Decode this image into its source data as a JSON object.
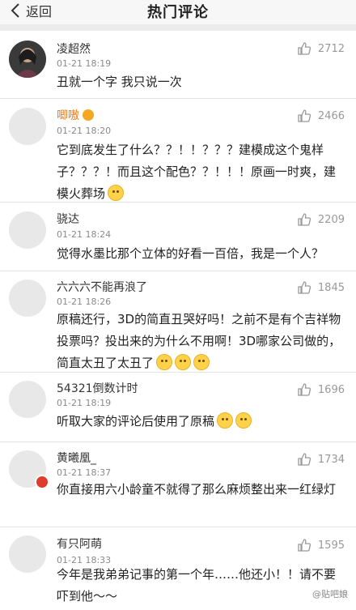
{
  "nav": {
    "back_label": "返回",
    "title": "热门评论"
  },
  "comments": [
    {
      "user": "凌超然",
      "time": "01-21 18:19",
      "likes": "2712",
      "text": "丑就一个字 我只说一次"
    },
    {
      "user": "唧嗷",
      "time": "01-21 18:20",
      "likes": "2466",
      "text": "它到底发生了什么？？！！？？？建模成这个鬼样子？？？！而且这个配色？？！！！原画一时爽，建模火葬场"
    },
    {
      "user": "骁达",
      "time": "01-21 18:24",
      "likes": "2209",
      "text": "觉得水墨比那个立体的好看一百倍，我是一个人？"
    },
    {
      "user": "六六六不能再浪了",
      "time": "01-21 18:26",
      "likes": "1845",
      "text": "原稿还行，3D的简直丑哭好吗！之前不是有个吉祥物投票吗？投出来的为什么不用啊！3D哪家公司做的，简直太丑了太丑了"
    },
    {
      "user": "54321倒数计时",
      "time": "01-21 18:19",
      "likes": "1696",
      "text": "听取大家的评论后使用了原稿"
    },
    {
      "user": "黄曦凰_",
      "time": "01-21 18:37",
      "likes": "1734",
      "text": "你直接用六小龄童不就得了那么麻烦整出来一红绿灯"
    },
    {
      "user": "有只阿萌",
      "time": "01-21 18:33",
      "likes": "1595",
      "text": "今年是我弟弟记事的第一个年……他还小！！请不要吓到他～～"
    }
  ],
  "watermark": "@贴吧娘",
  "colors": {
    "highlight_username": "#f07b1d",
    "verified_badge": "#e03c2d"
  }
}
